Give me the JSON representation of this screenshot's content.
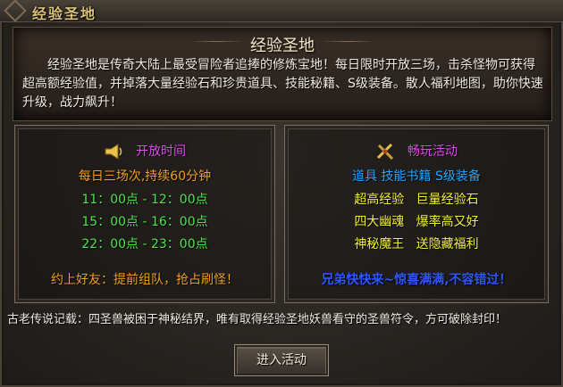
{
  "window": {
    "title": "经验圣地"
  },
  "banner": {
    "title": "经验圣地",
    "description": "经验圣地是传奇大陆上最受冒险者追捧的修炼宝地！每日限时开放三场，击杀怪物可获得超高额经验值，并掉落大量经验石和珍贵道具、技能秘籍、S级装备。散人福利地图，助你快速升级，战力飙升！"
  },
  "left_panel": {
    "icon": "megaphone-icon",
    "title": "开放时间",
    "subtitle": "每日三场次,持续60分钟",
    "times": [
      "11：00点 - 12：00点",
      "15：00点 - 16：00点",
      "22：00点 - 23：00点"
    ],
    "footer": "约上好友：提前组队，抢占刷怪！"
  },
  "right_panel": {
    "icon": "crossed-swords-icon",
    "title": "畅玩活动",
    "subtitle": "道具 技能书籍 S级装备",
    "rows": [
      [
        "超高经验",
        "巨量经验石"
      ],
      [
        "四大幽魂",
        "爆率高又好"
      ],
      [
        "神秘魔王",
        "送隐藏福利"
      ]
    ],
    "footer": "兄弟快快来~惊喜满满,不容错过！"
  },
  "legend": "古老传说记载：四圣兽被困于神秘结界，唯有取得经验圣地妖兽看守的圣兽符令，方可破除封印！",
  "button": {
    "label": "进入活动"
  },
  "colors": {
    "gold": "#d9c27a",
    "magenta": "#e04df0",
    "green": "#4ee24e",
    "cyan": "#22a8ff",
    "yellow": "#f2f23a",
    "blue": "#2f57ff"
  }
}
